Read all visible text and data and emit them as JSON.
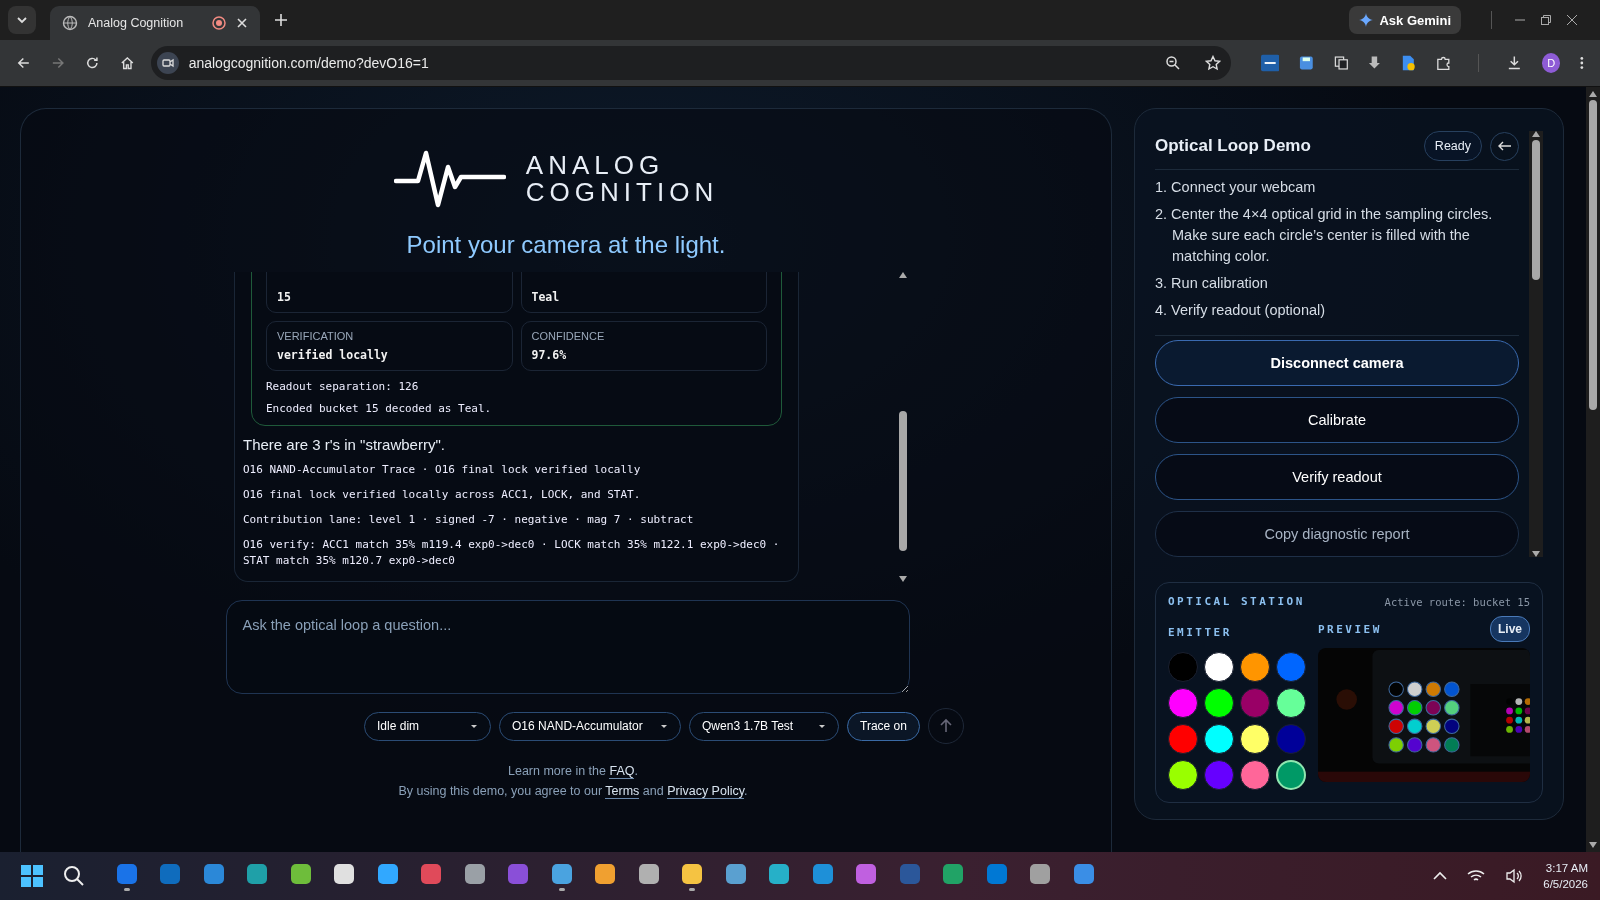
{
  "browser": {
    "tab": {
      "title": "Analog Cognition",
      "recording": true
    },
    "ask_button": "Ask Gemini",
    "url": "analogcognition.com/demo?devO16=1",
    "profile": "D"
  },
  "header": {
    "logo_line_1": "ANALOG",
    "logo_line_2": "COGNITION",
    "headline": "Point your camera at the light."
  },
  "result": {
    "cells": [
      {
        "value": "15"
      },
      {
        "value": "Teal"
      },
      {
        "label": "VERIFICATION",
        "value": "verified locally"
      },
      {
        "label": "CONFIDENCE",
        "value": "97.6%"
      }
    ],
    "notes": [
      "Readout separation: 126",
      "Encoded bucket 15 decoded as Teal."
    ]
  },
  "answer": "There are 3 r's in \"strawberry\".",
  "trace": [
    "O16 NAND-Accumulator Trace · O16 final lock verified locally",
    "O16 final lock verified locally across ACC1, LOCK, and STAT.",
    "Contribution lane: level 1 · signed -7 · negative · mag 7 · subtract",
    "O16 verify: ACC1 match 35% m119.4 exp0->dec0 · LOCK match 35% m122.1 exp0->dec0 · STAT match 35% m120.7 exp0->dec0"
  ],
  "input": {
    "placeholder": "Ask the optical loop a question..."
  },
  "controls": [
    {
      "kind": "select",
      "label": "Idle dim"
    },
    {
      "kind": "select",
      "label": "O16 NAND-Accumulator"
    },
    {
      "kind": "select",
      "label": "Qwen3 1.7B Test"
    },
    {
      "kind": "toggle",
      "label": "Trace on"
    }
  ],
  "footer": {
    "line_1": "Learn more in the ",
    "faq": "FAQ",
    "line_1_end": ".",
    "line_2": "By using this demo, you agree to our ",
    "terms": "Terms",
    "and": " and ",
    "privacy": "Privacy Policy",
    "line_2_end": "."
  },
  "panel": {
    "title": "Optical Loop Demo",
    "status": "Ready",
    "steps": [
      "1. Connect your webcam",
      "2. Center the 4×4 optical grid in the sampling circles. Make sure each circle’s center is filled with the matching color.",
      "3. Run calibration",
      "4. Verify readout (optional)"
    ],
    "buttons": [
      {
        "label": "Disconnect camera",
        "disabled": false,
        "bold": true
      },
      {
        "label": "Calibrate",
        "disabled": false,
        "bold": false
      },
      {
        "label": "Verify readout",
        "disabled": false,
        "bold": false
      },
      {
        "label": "Copy diagnostic report",
        "disabled": true,
        "bold": false
      }
    ]
  },
  "station": {
    "title": "OPTICAL STATION",
    "route": "Active route: bucket 15",
    "emitter_label": "EMITTER",
    "preview_label": "PREVIEW",
    "live": "Live",
    "swatches": [
      {
        "color": "#000000",
        "selected": false
      },
      {
        "color": "#ffffff",
        "selected": false
      },
      {
        "color": "#ff9500",
        "selected": false
      },
      {
        "color": "#0066ff",
        "selected": false
      },
      {
        "color": "#ff00ff",
        "selected": false
      },
      {
        "color": "#00ff00",
        "selected": false
      },
      {
        "color": "#990066",
        "selected": false
      },
      {
        "color": "#66ff99",
        "selected": false
      },
      {
        "color": "#ff0000",
        "selected": false
      },
      {
        "color": "#00ffff",
        "selected": false
      },
      {
        "color": "#ffff66",
        "selected": false
      },
      {
        "color": "#000099",
        "selected": false
      },
      {
        "color": "#99ff00",
        "selected": false
      },
      {
        "color": "#6600ff",
        "selected": false
      },
      {
        "color": "#ff6699",
        "selected": false
      },
      {
        "color": "#009966",
        "selected": true
      }
    ]
  },
  "taskbar": {
    "apps": [
      {
        "color": "#1a73e8",
        "running": true
      },
      {
        "color": "#0f6cbd",
        "running": false
      },
      {
        "color": "#2b88d8",
        "running": false
      },
      {
        "color": "#1fa0a8",
        "running": false
      },
      {
        "color": "#6ebd3b",
        "running": false
      },
      {
        "color": "#e0e0e0",
        "running": false
      },
      {
        "color": "#31a8ff",
        "running": false
      },
      {
        "color": "#e04a5a",
        "running": false
      },
      {
        "color": "#9aa0a6",
        "running": false
      },
      {
        "color": "#8a4fd8",
        "running": false
      },
      {
        "color": "#4aa3e0",
        "running": true
      },
      {
        "color": "#f0a030",
        "running": false
      },
      {
        "color": "#b0b0b0",
        "running": false
      },
      {
        "color": "#f5c342",
        "running": true
      },
      {
        "color": "#5aa0d0",
        "running": false
      },
      {
        "color": "#26b0c8",
        "running": false
      },
      {
        "color": "#1e90d8",
        "running": false
      },
      {
        "color": "#c060e0",
        "running": false
      },
      {
        "color": "#2b579a",
        "running": false
      },
      {
        "color": "#21a366",
        "running": false
      },
      {
        "color": "#0078d4",
        "running": false
      },
      {
        "color": "#a0a0a0",
        "running": false
      },
      {
        "color": "#3a8ee6",
        "running": false
      }
    ],
    "time": "3:17 AM",
    "date": "6/5/2026"
  }
}
